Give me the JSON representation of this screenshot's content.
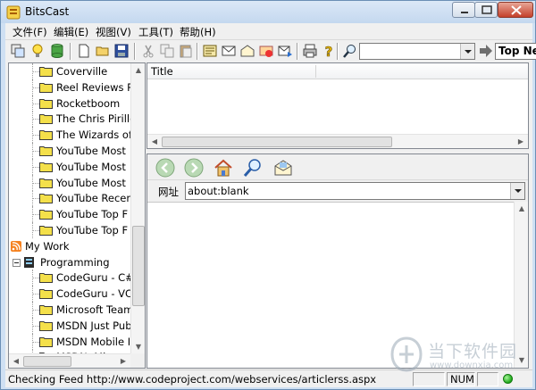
{
  "window": {
    "title": "BitsCast"
  },
  "menubar": {
    "items": [
      "文件(F)",
      "编辑(E)",
      "视图(V)",
      "工具(T)",
      "帮助(H)"
    ]
  },
  "toolbar": {
    "search": {
      "value": "",
      "placeholder": ""
    },
    "feed_selector": "Top Ne"
  },
  "tree": {
    "items": [
      {
        "label": "Coverville",
        "type": "folder",
        "level": 2
      },
      {
        "label": "Reel Reviews Ra",
        "type": "folder",
        "level": 2
      },
      {
        "label": "Rocketboom",
        "type": "folder",
        "level": 2
      },
      {
        "label": "The Chris Pirillo",
        "type": "folder",
        "level": 2
      },
      {
        "label": "The Wizards of",
        "type": "folder",
        "level": 2
      },
      {
        "label": "YouTube  Most",
        "type": "folder",
        "level": 2
      },
      {
        "label": "YouTube  Most",
        "type": "folder",
        "level": 2
      },
      {
        "label": "YouTube  Most",
        "type": "folder",
        "level": 2
      },
      {
        "label": "YouTube  Recen",
        "type": "folder",
        "level": 2
      },
      {
        "label": "YouTube  Top F",
        "type": "folder",
        "level": 2
      },
      {
        "label": "YouTube  Top F",
        "type": "folder",
        "level": 2
      },
      {
        "label": "My Work",
        "type": "rss",
        "level": 0
      },
      {
        "label": "Programming",
        "type": "book",
        "level": 0
      },
      {
        "label": "CodeGuru - C#",
        "type": "folder",
        "level": 2
      },
      {
        "label": "CodeGuru - VC",
        "type": "folder",
        "level": 2
      },
      {
        "label": "Microsoft Team",
        "type": "folder",
        "level": 2
      },
      {
        "label": "MSDN Just Pub",
        "type": "folder",
        "level": 2
      },
      {
        "label": "MSDN Mobile I",
        "type": "folder",
        "level": 2
      },
      {
        "label": "MSDN: Microso",
        "type": "folder",
        "level": 2
      }
    ]
  },
  "list": {
    "columns": [
      "Title"
    ]
  },
  "browser": {
    "address_label": "网址",
    "address_value": "about:blank"
  },
  "status": {
    "text": "Checking Feed http://www.codeproject.com/webservices/articlerss.aspx",
    "num": "NUM"
  },
  "watermark": {
    "text": "当下软件园",
    "url": "www.downxia.com"
  },
  "colors": {
    "folder": "#f4e04a",
    "rss": "#f58220",
    "led": "#1ea81a"
  }
}
